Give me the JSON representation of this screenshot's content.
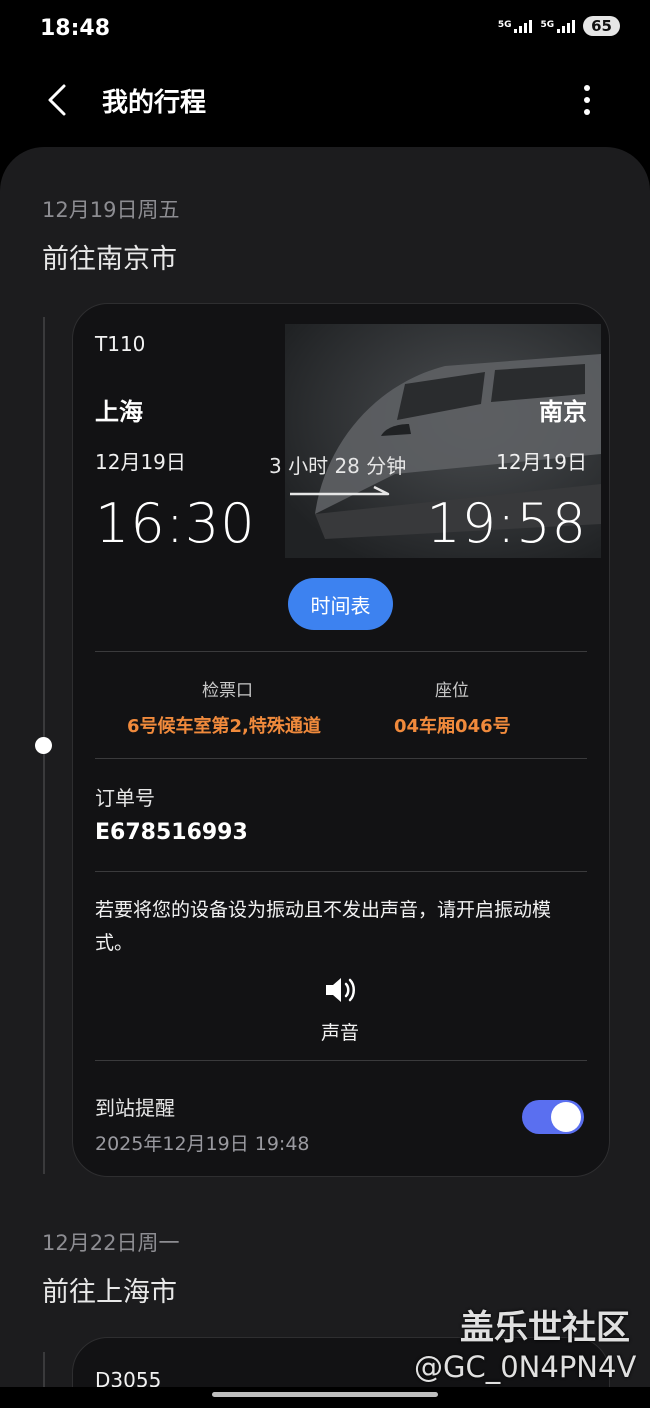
{
  "status_bar": {
    "time": "18:48",
    "network_1": "5G",
    "network_2": "5G",
    "battery": "65"
  },
  "header": {
    "title": "我的行程"
  },
  "trips": [
    {
      "date": "12月19日周五",
      "destination": "前往南京市",
      "train_number": "T110",
      "departure": {
        "station": "上海",
        "date": "12月19日",
        "time": "16:30"
      },
      "arrival": {
        "station": "南京",
        "date": "12月19日",
        "time": "19:58"
      },
      "duration": "3 小时 28 分钟",
      "schedule_button": "时间表",
      "gate_label": "检票口",
      "gate_value": "6号候车室第2,特殊通道",
      "seat_label": "座位",
      "seat_value": "04车厢046号",
      "order_label": "订单号",
      "order_number": "E678516993",
      "vibrate_notice": "若要将您的设备设为振动且不发出声音，请开启振动模式。",
      "sound_label": "声音",
      "reminder_label": "到站提醒",
      "reminder_time": "2025年12月19日 19:48",
      "reminder_enabled": true
    },
    {
      "date": "12月22日周一",
      "destination": "前往上海市",
      "train_number": "D3055"
    }
  ],
  "watermark": {
    "line1": "盖乐世社区",
    "line2": "@GC_0N4PN4V"
  },
  "icons": [
    "back-icon",
    "more-icon",
    "train-icon",
    "arrow-icon",
    "speaker-icon"
  ],
  "colors": {
    "accent_blue": "#3d82f0",
    "highlight_orange": "#f08a3c",
    "toggle_on": "#5a6ff0",
    "card_bg": "#121214",
    "panel_bg": "#1c1c1e"
  }
}
